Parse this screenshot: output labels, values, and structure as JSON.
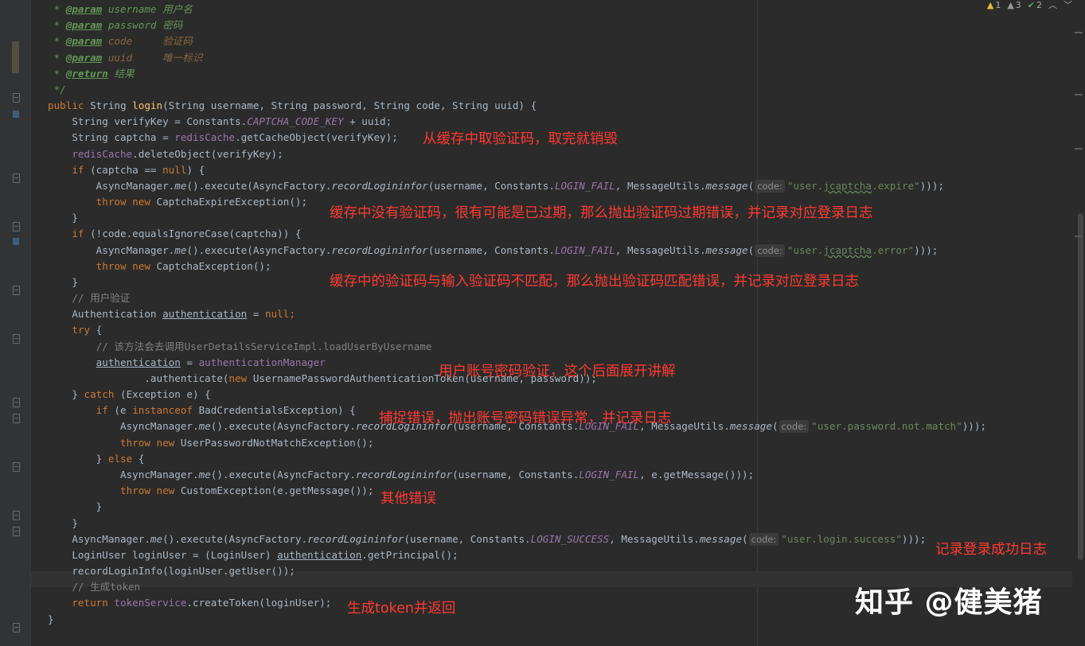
{
  "status": {
    "warnings": "1",
    "weak_warnings": "3",
    "typos": "2"
  },
  "code": {
    "l1": "@param",
    "l1b": " username 用户名",
    "l2b": " password 密码",
    "l3b": " code     验证码",
    "l4b": " uuid     唯一标识",
    "l5": "@return",
    "l5b": " 结果",
    "l6": " */",
    "l7a": "public",
    "l7b": " String ",
    "l7c": "login",
    "l7d": "(String username, String password, String code, String uuid) {",
    "l8a": "String verifyKey = Constants.",
    "l8b": "CAPTCHA_CODE_KEY",
    "l8c": " + uuid;",
    "l9a": "String captcha = ",
    "l9b": "redisCache",
    "l9c": ".getCacheObject(verifyKey);",
    "l10a": "redisCache",
    "l10b": ".deleteObject(verifyKey);",
    "if": "if",
    "l11b": " (captcha == ",
    "null": "null",
    "l11d": ") {",
    "am": "AsyncManager.",
    "me": "me",
    "exec": "().execute(AsyncFactory.",
    "rli": "recordLogininfor",
    "un": "(username, Constants.",
    "fail": "LOGIN_FAIL",
    "mu": ", MessageUtils.",
    "msg": "message",
    "paren": "(",
    "codehint": "code:",
    "s1a": "\"user.",
    "jc": "jcaptcha",
    "s1b": ".expire\"",
    "close3": ")));",
    "throw": "throw",
    "new": "new",
    "l13b": " CaptchaExpireException();",
    "brace": "}",
    "l15b": " (!code.equalsIgnoreCase(captcha)) {",
    "s2b": ".error\"",
    "l17b": " CaptchaException();",
    "c1": "// 用户验证",
    "l20a": "Authentication ",
    "auth": "authentication",
    "l20c": " = ",
    "semi": ";",
    "try": "try",
    "l21b": " {",
    "c2": "// 该方法会去调用UserDetailsServiceImpl.loadUserByUsername",
    "l23b": " = ",
    "authMgr": "authenticationManager",
    "l24a": ".authenticate(",
    "l24b": " UsernamePasswordAuthenticationToken(username, password));",
    "l25a": "} ",
    "catch": "catch",
    "l25b": " (Exception e) {",
    "l26b": " (e ",
    "instof": "instanceof",
    "l26c": " BadCredentialsException) {",
    "s3": "\"user.password.not.match\"",
    "l28b": " UserPasswordNotMatchException();",
    "else": "else",
    "l29b": " {",
    "l30c": ", e.getMessage()));",
    "l31b": " CustomException(e.getMessage());",
    "success": "LOGIN_SUCCESS",
    "s4": "\"user.login.success\"",
    "l35a": "LoginUser loginUser = (LoginUser) ",
    "l35b": ".getPrincipal();",
    "l36": "recordLoginInfo(loginUser.getUser());",
    "c3": "// 生成token",
    "return": "return",
    "l38a": " tokenService",
    "l38b": ".createToken(loginUser);",
    "end": "}"
  },
  "annotations": {
    "a1": "从缓存中取验证码，取完就销毁",
    "a2": "缓存中没有验证码，很有可能是已过期，那么抛出验证码过期错误，并记录对应登录日志",
    "a3": "缓存中的验证码与输入验证码不匹配，那么抛出验证码匹配错误，并记录对应登录日志",
    "a4": "用户账号密码验证，这个后面展开讲解",
    "a5": "捕捉错误，抛出账号密码错误异常，并记录日志",
    "a6": "其他错误",
    "a7": "记录登录成功日志",
    "a8": "生成token并返回"
  },
  "watermark": "知乎 @健美猪"
}
